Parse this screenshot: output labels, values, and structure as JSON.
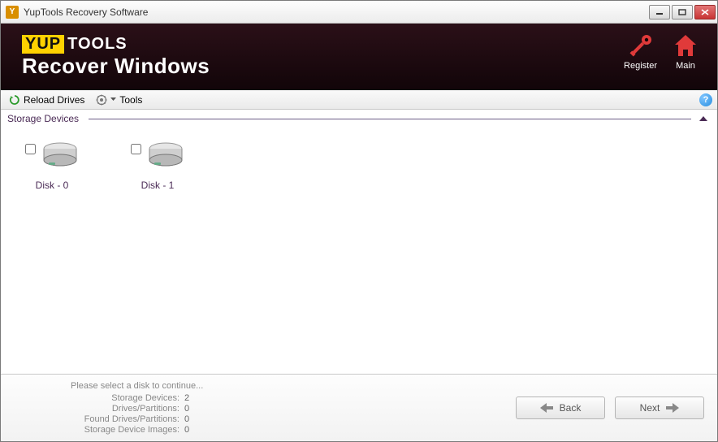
{
  "window": {
    "title": "YupTools Recovery Software"
  },
  "banner": {
    "logo_left": "YUP",
    "logo_right": "TOOLS",
    "subtitle": "Recover Windows",
    "register_label": "Register",
    "main_label": "Main"
  },
  "toolbar": {
    "reload_label": "Reload Drives",
    "tools_label": "Tools"
  },
  "section": {
    "title": "Storage Devices"
  },
  "devices": [
    {
      "label": "Disk - 0",
      "checked": false
    },
    {
      "label": "Disk - 1",
      "checked": false
    }
  ],
  "footer": {
    "message": "Please select a disk to continue...",
    "stats": {
      "storage_devices_label": "Storage Devices:",
      "storage_devices_value": "2",
      "drives_partitions_label": "Drives/Partitions:",
      "drives_partitions_value": "0",
      "found_drives_label": "Found Drives/Partitions:",
      "found_drives_value": "0",
      "images_label": "Storage Device Images:",
      "images_value": "0"
    },
    "back_label": "Back",
    "next_label": "Next"
  }
}
